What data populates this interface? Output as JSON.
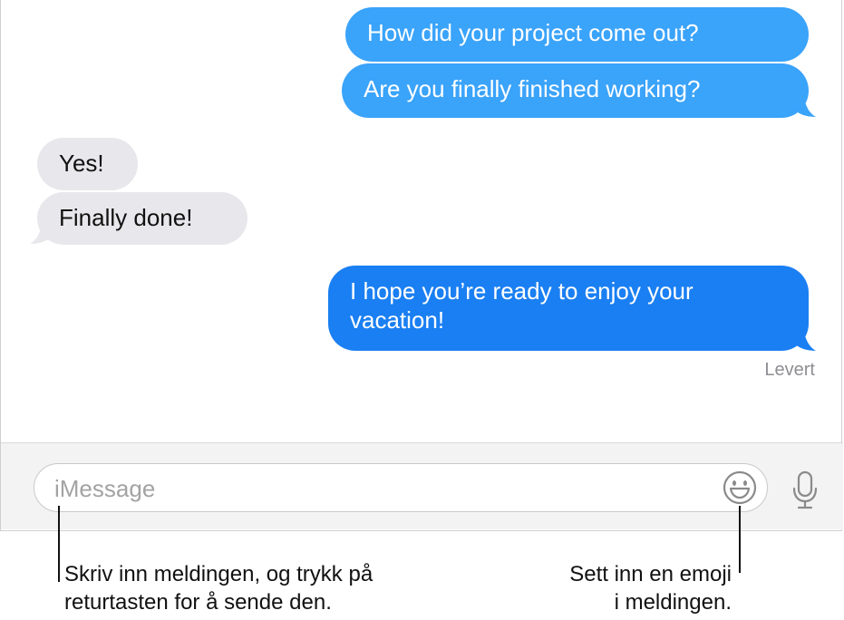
{
  "conversation": {
    "messages": [
      {
        "direction": "outgoing",
        "text": "How did your project come out?"
      },
      {
        "direction": "outgoing",
        "text": "Are you finally finished working?"
      },
      {
        "direction": "incoming",
        "text": "Yes!"
      },
      {
        "direction": "incoming",
        "text": "Finally done!"
      },
      {
        "direction": "outgoing",
        "text_line1": "I hope you’re ready to enjoy your",
        "text_line2": "vacation!"
      }
    ],
    "status": "Levert"
  },
  "composer": {
    "placeholder": "iMessage",
    "emoji_icon": "emoji-smiley-icon",
    "mic_icon": "microphone-icon"
  },
  "callouts": {
    "left": {
      "line1": "Skriv inn meldingen, og trykk på",
      "line2": "returtasten for å sende den."
    },
    "right": {
      "line1": "Sett inn en emoji",
      "line2": "i meldingen."
    }
  },
  "colors": {
    "outgoing_light": "#3aa3fa",
    "outgoing_dark": "#1a7ff2",
    "incoming": "#e8e8ec",
    "status_gray": "#8e8e93"
  }
}
